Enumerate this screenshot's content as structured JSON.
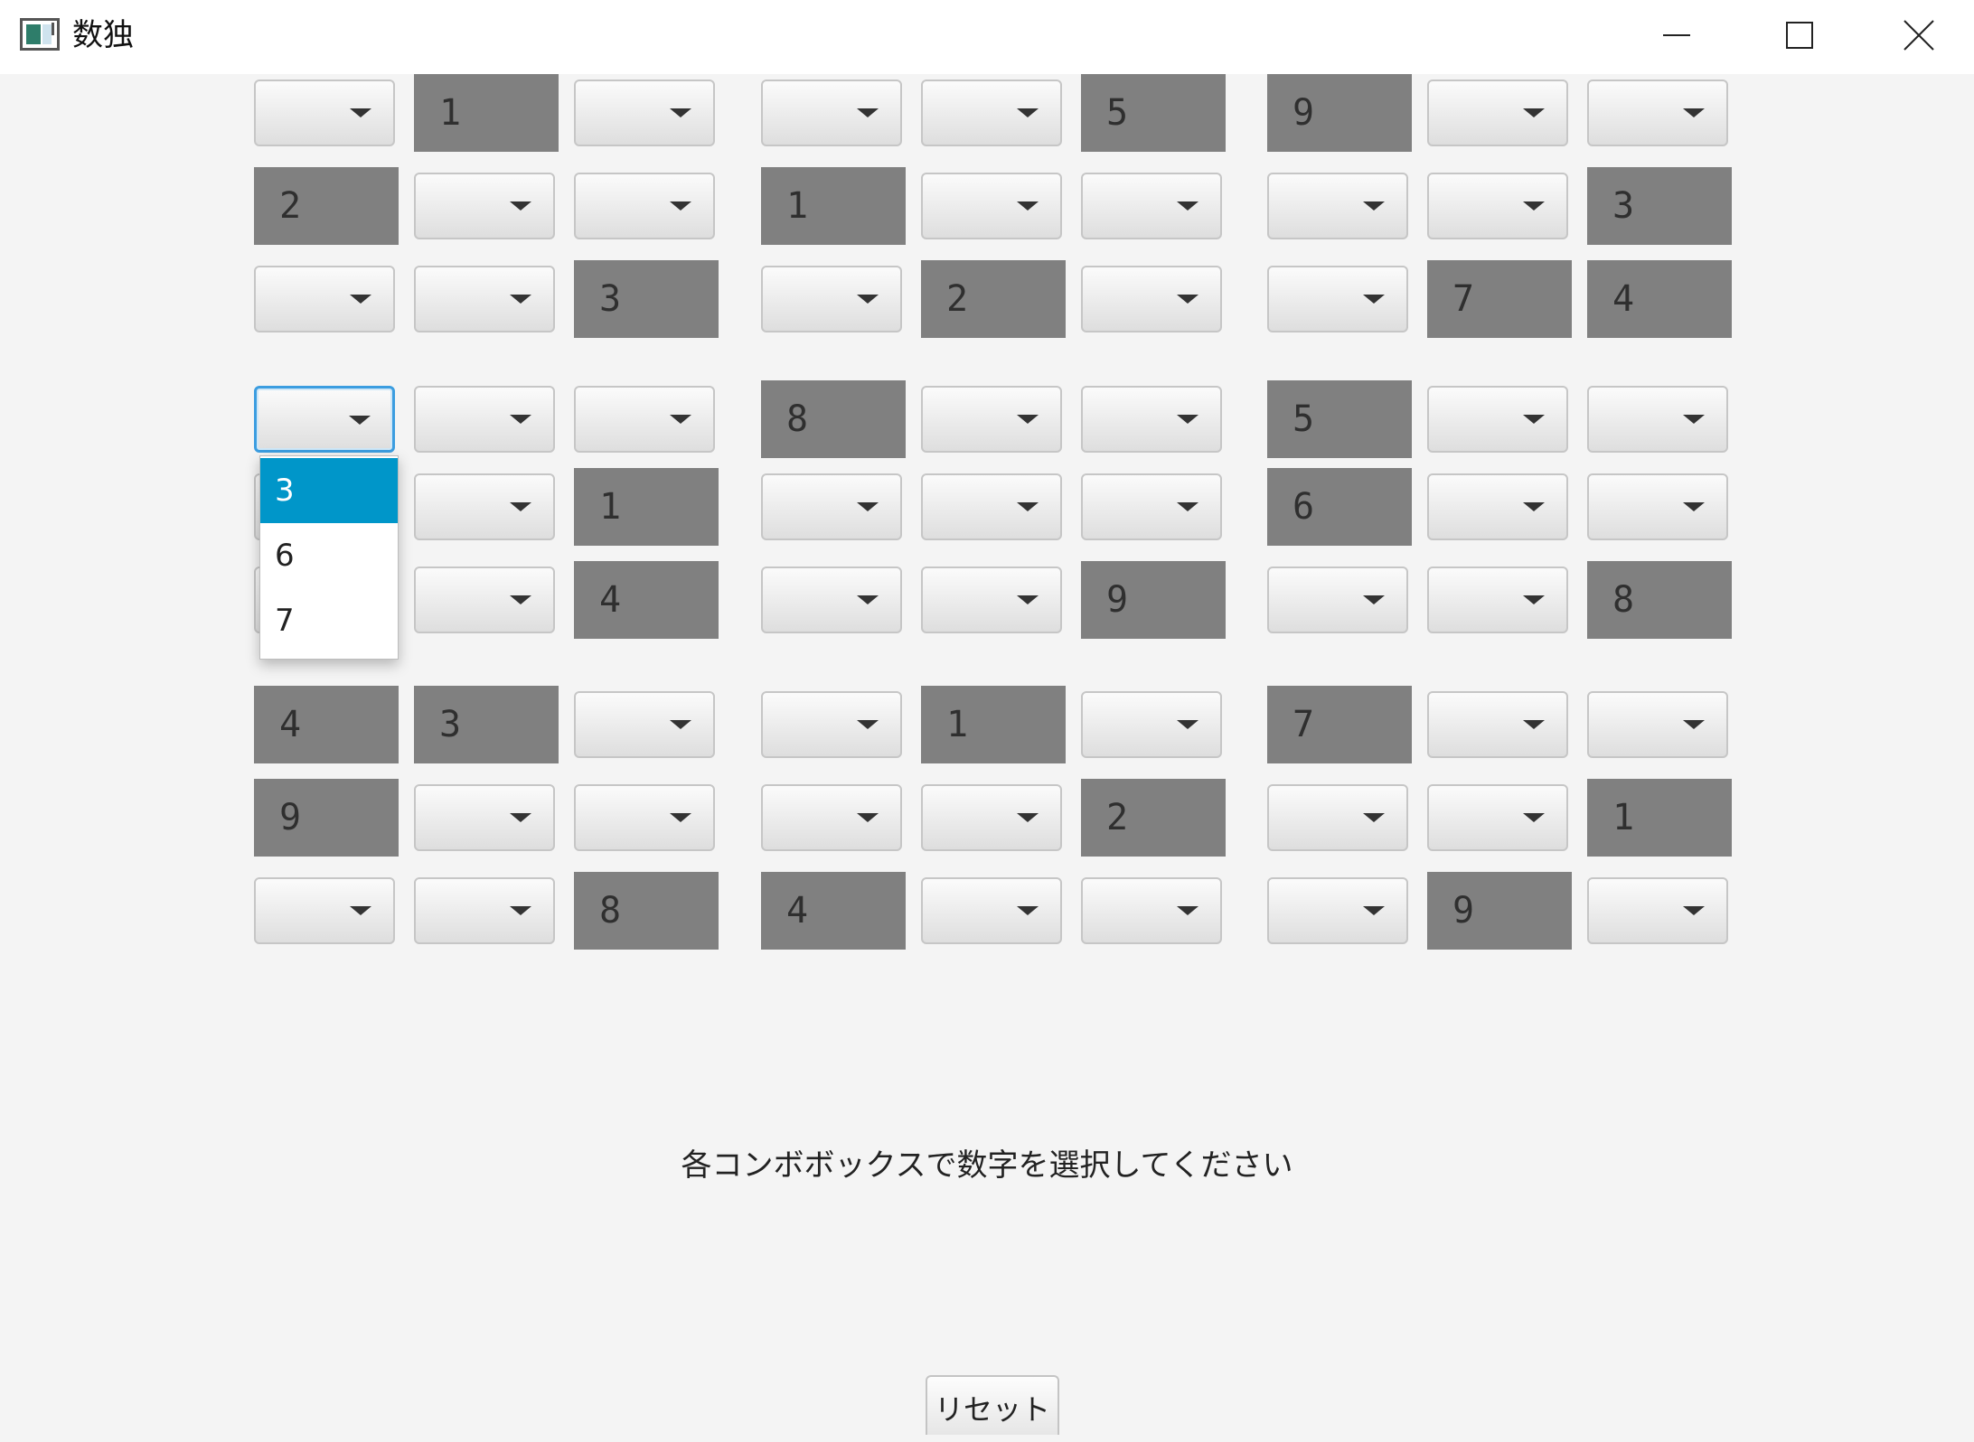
{
  "window": {
    "title": "数独"
  },
  "board": {
    "rows": [
      [
        "",
        "1",
        "",
        "",
        "",
        "5",
        "9",
        "",
        ""
      ],
      [
        "2",
        "",
        "",
        "1",
        "",
        "",
        "",
        "",
        "3"
      ],
      [
        "",
        "",
        "3",
        "",
        "2",
        "",
        "",
        "7",
        "4"
      ],
      [
        "",
        "",
        "",
        "8",
        "",
        "",
        "5",
        "",
        ""
      ],
      [
        "",
        "",
        "1",
        "",
        "",
        "",
        "6",
        "",
        ""
      ],
      [
        "",
        "",
        "4",
        "",
        "",
        "9",
        "",
        "",
        "8"
      ],
      [
        "4",
        "3",
        "",
        "",
        "1",
        "",
        "7",
        "",
        ""
      ],
      [
        "9",
        "",
        "",
        "",
        "",
        "2",
        "",
        "",
        "1"
      ],
      [
        "",
        "",
        "8",
        "4",
        "",
        "",
        "",
        "9",
        ""
      ]
    ],
    "focused_cell": [
      3,
      0
    ]
  },
  "dropdown": {
    "options": [
      "3",
      "6",
      "7"
    ],
    "selected_index": 0
  },
  "status": {
    "message": "各コンボボックスで数字を選択してください"
  },
  "buttons": {
    "reset_label": "リセット"
  },
  "colors": {
    "given_cell": "#808080",
    "selection": "#0096c9",
    "focus": "#3b9de0"
  }
}
